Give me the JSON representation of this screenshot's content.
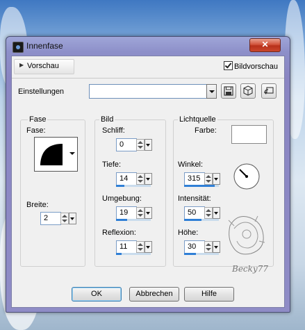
{
  "dialog": {
    "title": "Innenfase",
    "close_glyph": "✕"
  },
  "preview": {
    "toggle_label": "Vorschau",
    "image_preview_label": "Bildvorschau",
    "image_preview_checked": true
  },
  "settings": {
    "label": "Einstellungen",
    "value": "",
    "tool_icons": [
      "save-icon",
      "cube-icon",
      "reset-icon"
    ]
  },
  "fase": {
    "group_title": "Fase",
    "shape_label": "Fase:",
    "width_label": "Breite:",
    "width_value": "2"
  },
  "bild": {
    "group_title": "Bild",
    "schliff_label": "Schliff:",
    "schliff_value": "0",
    "tiefe_label": "Tiefe:",
    "tiefe_value": "14",
    "umgebung_label": "Umgebung:",
    "umgebung_value": "19",
    "reflexion_label": "Reflexion:",
    "reflexion_value": "11"
  },
  "licht": {
    "group_title": "Lichtquelle",
    "farbe_label": "Farbe:",
    "farbe_color": "#ffffff",
    "winkel_label": "Winkel:",
    "winkel_value": "315",
    "intensitaet_label": "Intensität:",
    "intensitaet_value": "50",
    "hoehe_label": "Höhe:",
    "hoehe_value": "30"
  },
  "buttons": {
    "ok": "OK",
    "cancel": "Abbrechen",
    "help": "Hilfe"
  },
  "watermark": "Becky77",
  "colors": {
    "accent": "#2f7fd6",
    "close": "#c9462c",
    "frame": "#8d8fc9"
  }
}
